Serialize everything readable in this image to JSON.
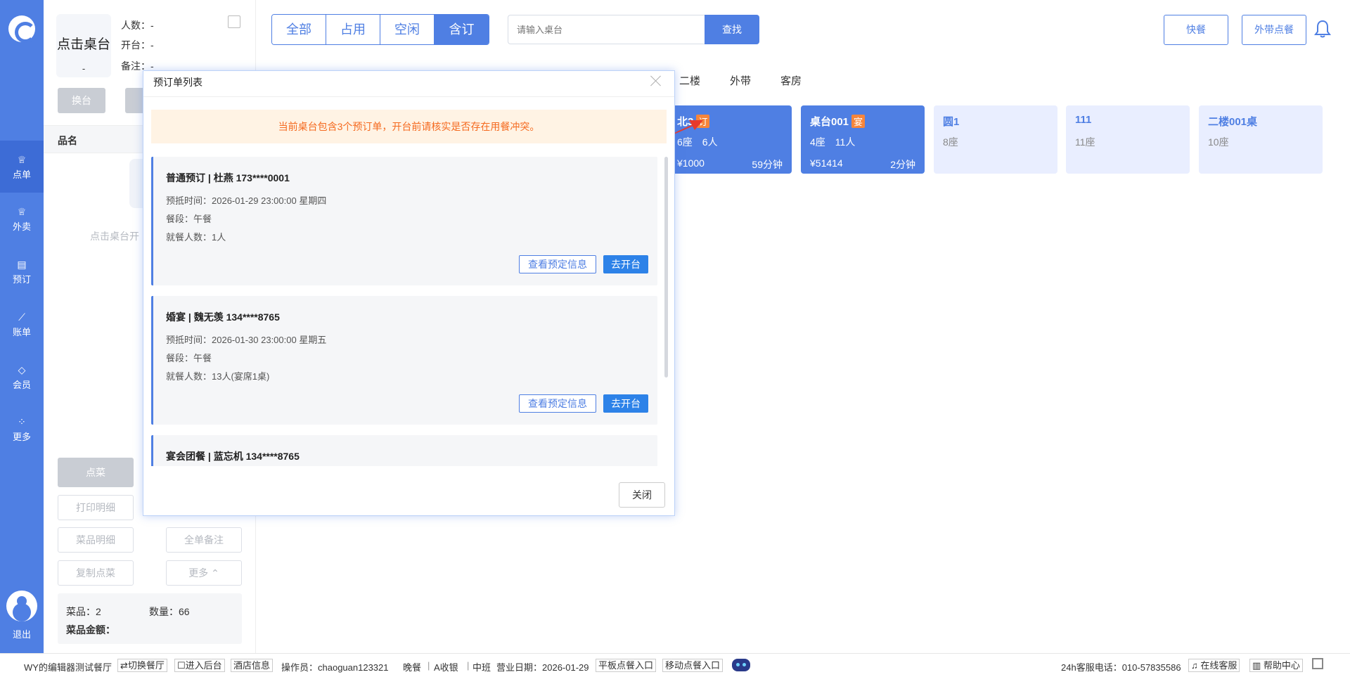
{
  "nav": {
    "items": [
      {
        "label": "点单",
        "icon": "chef-hat-icon"
      },
      {
        "label": "外卖",
        "icon": "chef-hat-icon"
      },
      {
        "label": "预订",
        "icon": "book-icon"
      },
      {
        "label": "账单",
        "icon": "chart-icon"
      },
      {
        "label": "会员",
        "icon": "diamond-icon"
      },
      {
        "label": "更多",
        "icon": "grid-icon"
      }
    ],
    "logout": "退出"
  },
  "panel": {
    "table_title": "点击桌台",
    "table_dash": "-",
    "people": "人数：-",
    "open_time": "开台：-",
    "remark": "备注：-",
    "swap_btn": "换台",
    "col_name": "品名",
    "empty_text": "点击桌台开",
    "order_btn": "点菜",
    "print_btn": "打印明细",
    "dish_detail_btn": "菜品明细",
    "note_btn": "全单备注",
    "copy_btn": "复制点菜",
    "more_btn": "更多 ⌃",
    "dish_count": "菜品：2",
    "qty": "数量：66",
    "amount": "菜品金额："
  },
  "filters": {
    "items": [
      "全部",
      "占用",
      "空闲",
      "含订"
    ],
    "active": "含订"
  },
  "search": {
    "placeholder": "请输入桌台",
    "button": "查找"
  },
  "top_buttons": {
    "fast": "快餐",
    "takeaway": "外带点餐"
  },
  "areas": [
    "二楼",
    "外带",
    "客房"
  ],
  "tables": [
    {
      "name": "北3",
      "badge": "订",
      "info": "6座　6人",
      "price": "¥1000",
      "time": "59分钟"
    },
    {
      "name": "桌台001",
      "badge": "宴",
      "info": "4座　11人",
      "price": "¥51414",
      "time": "2分钟"
    },
    {
      "name": "圆1",
      "info": "8座"
    },
    {
      "name": "111",
      "info": "11座"
    },
    {
      "name": "二楼001桌",
      "info": "10座"
    }
  ],
  "modal": {
    "title": "预订单列表",
    "warning": "当前桌台包含3个预订单，开台前请核实是否存在用餐冲突。",
    "reservations": [
      {
        "title": "普通预订 | 杜燕 173****0001",
        "arrive": "预抵时间：2026-01-29 23:00:00 星期四",
        "meal": "餐段：午餐",
        "people": "就餐人数：1人"
      },
      {
        "title": "婚宴 | 魏无羡 134****8765",
        "arrive": "预抵时间：2026-01-30 23:00:00 星期五",
        "meal": "餐段：午餐",
        "people": "就餐人数：13人(宴席1桌)"
      },
      {
        "title": "宴会团餐 | 蓝忘机 134****8765"
      }
    ],
    "view_btn": "查看预定信息",
    "open_btn": "去开台",
    "close_btn": "关闭"
  },
  "statusbar": {
    "restaurant": "WY的编辑器测试餐厅",
    "switch": "⇄切换餐厅",
    "backend": "☐进入后台",
    "hotel": "酒店信息",
    "operator": "操作员：chaoguan123321",
    "meal": "晚餐",
    "cashier": "A收银",
    "shift": "中班",
    "biz_date": "营业日期：2026-01-29",
    "tablet": "平板点餐入口",
    "mobile": "移动点餐入口",
    "hotline": "24h客服电话：010-57835586",
    "online": "在线客服",
    "help": "帮助中心"
  }
}
